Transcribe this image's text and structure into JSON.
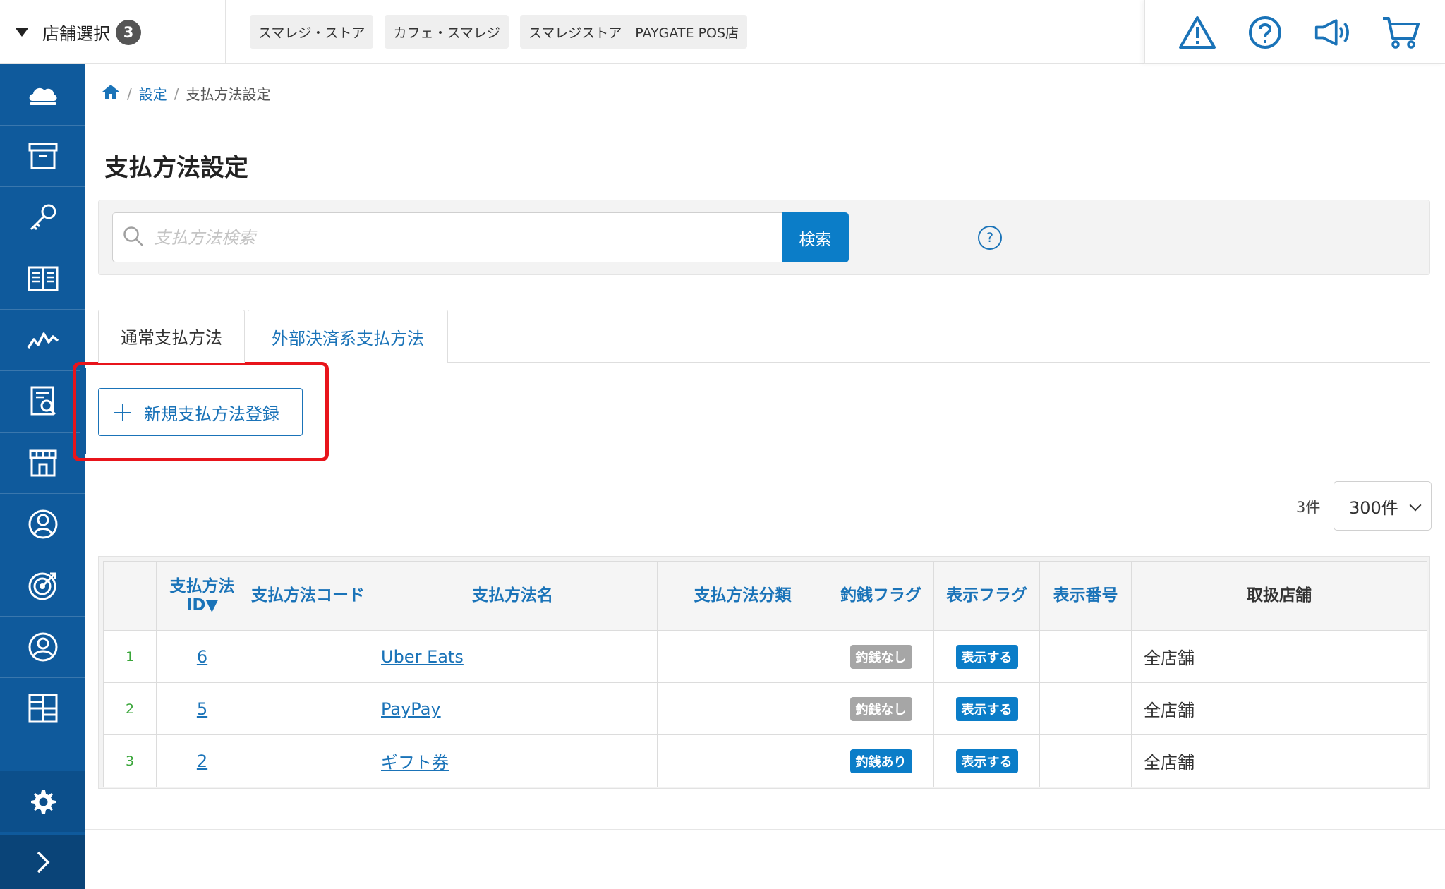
{
  "header": {
    "store_select_label": "店舗選択",
    "store_count": "3",
    "stores": [
      "スマレジ・ストア",
      "カフェ・スマレジ",
      "スマレジストア　PAYGATE POS店"
    ],
    "icons": [
      "warning-icon",
      "help-icon",
      "megaphone-icon",
      "cart-icon"
    ]
  },
  "sidebar": {
    "items": [
      "cloud-icon",
      "archive-box-icon",
      "key-icon",
      "book-icon",
      "chart-line-icon",
      "report-icon",
      "store-icon",
      "user-circle-icon",
      "target-icon",
      "account-icon",
      "grid-icon",
      "briefcase-icon"
    ],
    "bottom": [
      "gear-icon",
      "chevron-right-icon"
    ],
    "color": "#0f5a9c"
  },
  "breadcrumb": {
    "home_icon": "home-icon",
    "settings": "設定",
    "current": "支払方法設定"
  },
  "page_title": "支払方法設定",
  "search": {
    "placeholder": "支払方法検索",
    "button": "検索",
    "help": "?"
  },
  "tabs": {
    "normal": "通常支払方法",
    "external": "外部決済系支払方法"
  },
  "new_button": {
    "plus": "+",
    "label": "新規支払方法登録"
  },
  "pagination": {
    "count": "3件",
    "per_page": "300件"
  },
  "table": {
    "headers": {
      "id": "支払方法\nID▼",
      "code": "支払方法コード",
      "name": "支払方法名",
      "category": "支払方法分類",
      "change_flag": "釣銭フラグ",
      "display_flag": "表示フラグ",
      "display_no": "表示番号",
      "stores": "取扱店舗"
    },
    "rows": [
      {
        "no": "1",
        "id": "6",
        "code": "",
        "name": "Uber Eats",
        "category": "",
        "change_flag": "釣銭なし",
        "display_flag": "表示する",
        "display_no": "",
        "stores": "全店舗"
      },
      {
        "no": "2",
        "id": "5",
        "code": "",
        "name": "PayPay",
        "category": "",
        "change_flag": "釣銭なし",
        "display_flag": "表示する",
        "display_no": "",
        "stores": "全店舗"
      },
      {
        "no": "3",
        "id": "2",
        "code": "",
        "name": "ギフト券",
        "category": "",
        "change_flag": "釣銭あり",
        "display_flag": "表示する",
        "display_no": "",
        "stores": "全店舗"
      }
    ]
  },
  "colors": {
    "accent": "#0b7dc8",
    "link": "#1a73b8",
    "highlight": "#e8141b",
    "rownum": "#3aa63a"
  }
}
